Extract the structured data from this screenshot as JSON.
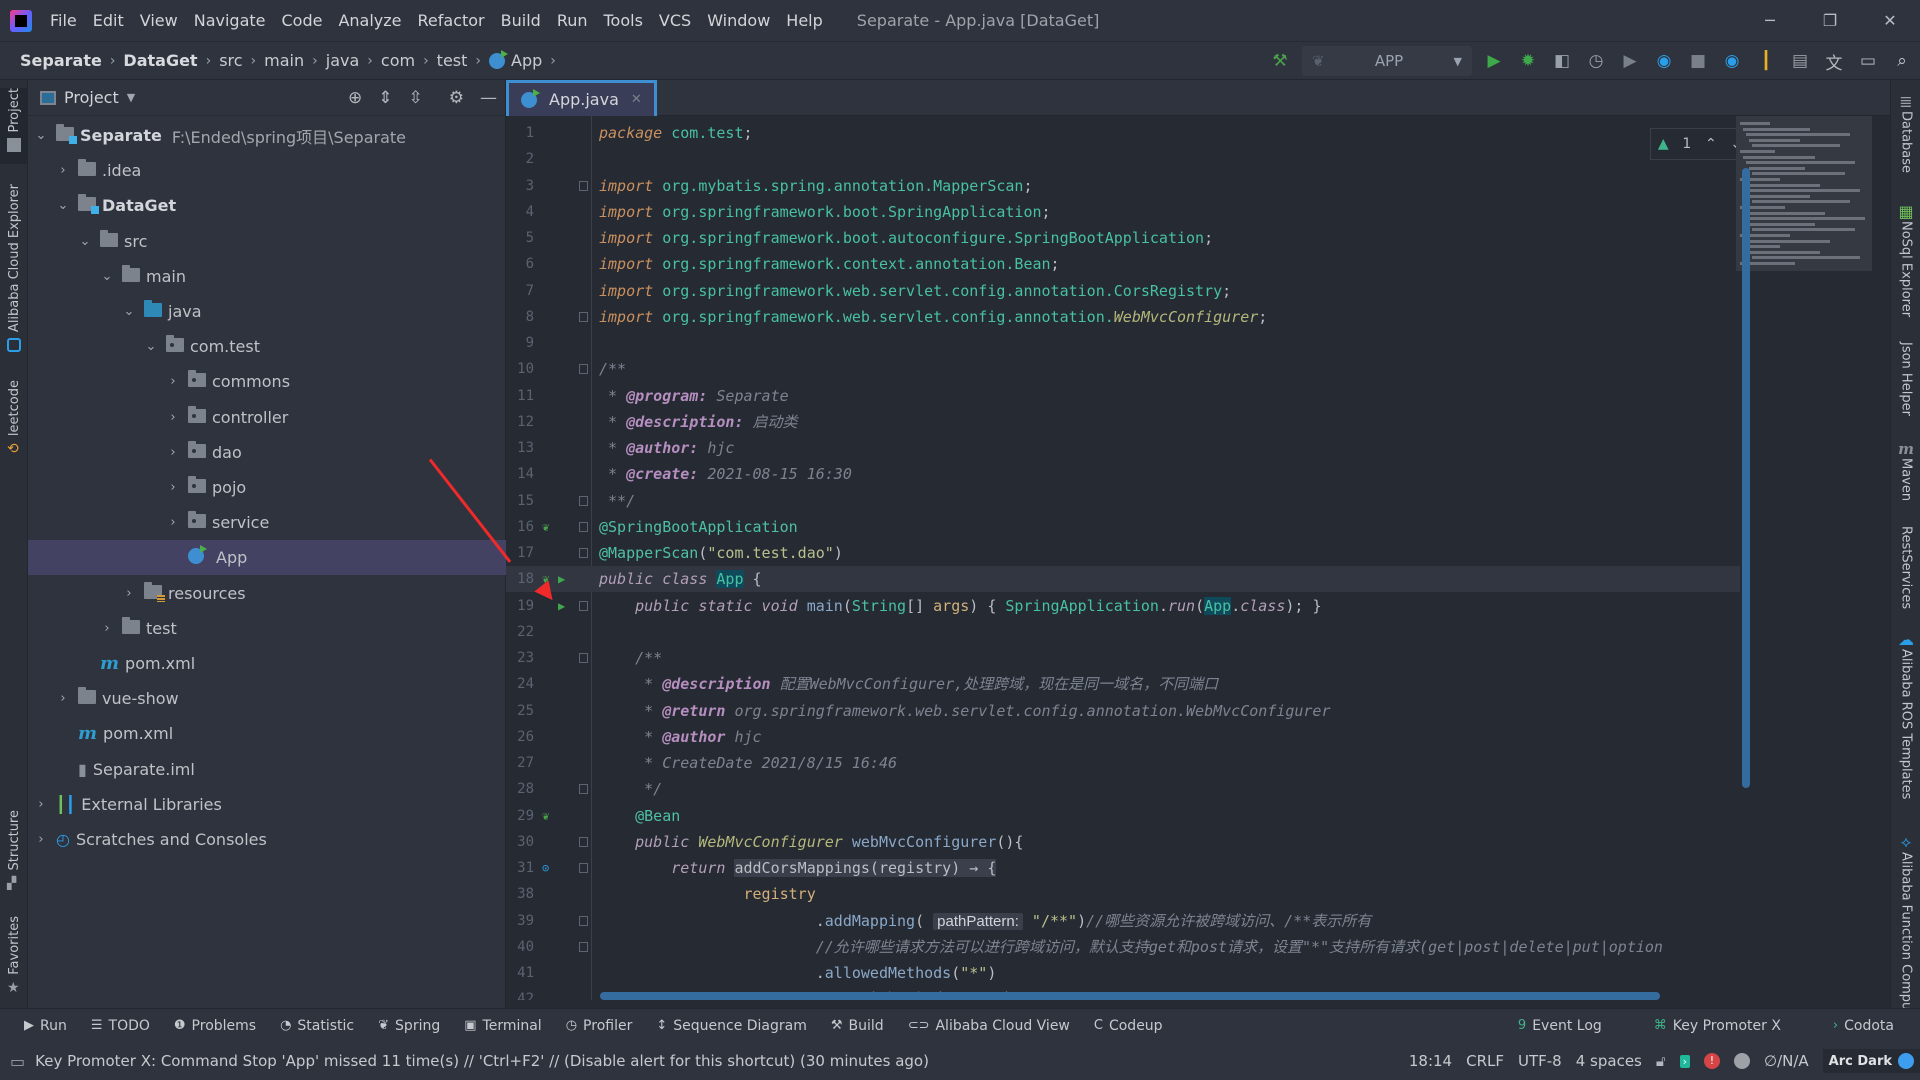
{
  "window": {
    "title": "Separate - App.java [DataGet]",
    "menu": [
      "File",
      "Edit",
      "View",
      "Navigate",
      "Code",
      "Analyze",
      "Refactor",
      "Build",
      "Run",
      "Tools",
      "VCS",
      "Window",
      "Help"
    ],
    "controls": {
      "minimize": "─",
      "maximize": "❐",
      "close": "✕"
    }
  },
  "breadcrumb": [
    "Separate",
    "DataGet",
    "src",
    "main",
    "java",
    "com",
    "test",
    "App"
  ],
  "toolbar": {
    "run_config": "APP",
    "icons": [
      "build-hammer-icon",
      "run-icon",
      "debug-icon",
      "coverage-icon",
      "profile-icon",
      "run-dropdown-icon",
      "resume-icon",
      "dashboard-icon",
      "stop-icon",
      "tool-icon",
      "git-icon",
      "project-structure-icon",
      "translate-icon",
      "presentation-icon",
      "search-icon"
    ]
  },
  "left_strip": [
    "Project",
    "Alibaba Cloud Explorer",
    "leetcode",
    "Structure",
    "Favorites"
  ],
  "project": {
    "title": "Project",
    "tree": [
      {
        "label": "Separate",
        "path": "F:\\Ended\\spring项目\\Separate",
        "depth": 0,
        "expanded": true,
        "icon": "module",
        "bold": true
      },
      {
        "label": ".idea",
        "depth": 1,
        "expanded": false,
        "icon": "folder"
      },
      {
        "label": "DataGet",
        "depth": 1,
        "expanded": true,
        "icon": "module",
        "bold": true
      },
      {
        "label": "src",
        "depth": 2,
        "expanded": true,
        "icon": "folder"
      },
      {
        "label": "main",
        "depth": 3,
        "expanded": true,
        "icon": "folder"
      },
      {
        "label": "java",
        "depth": 4,
        "expanded": true,
        "icon": "src"
      },
      {
        "label": "com.test",
        "depth": 5,
        "expanded": true,
        "icon": "pkg"
      },
      {
        "label": "commons",
        "depth": 6,
        "expanded": false,
        "icon": "pkg"
      },
      {
        "label": "controller",
        "depth": 6,
        "expanded": false,
        "icon": "pkg"
      },
      {
        "label": "dao",
        "depth": 6,
        "expanded": false,
        "icon": "pkg"
      },
      {
        "label": "pojo",
        "depth": 6,
        "expanded": false,
        "icon": "pkg"
      },
      {
        "label": "service",
        "depth": 6,
        "expanded": false,
        "icon": "pkg"
      },
      {
        "label": "App",
        "depth": 6,
        "icon": "app",
        "selected": true
      },
      {
        "label": "resources",
        "depth": 4,
        "expanded": false,
        "icon": "res"
      },
      {
        "label": "test",
        "depth": 3,
        "expanded": false,
        "icon": "folder"
      },
      {
        "label": "pom.xml",
        "depth": 2,
        "icon": "maven"
      },
      {
        "label": "vue-show",
        "depth": 1,
        "expanded": false,
        "icon": "folder"
      },
      {
        "label": "pom.xml",
        "depth": 1,
        "icon": "maven"
      },
      {
        "label": "Separate.iml",
        "depth": 1,
        "icon": "iml"
      },
      {
        "label": "External Libraries",
        "depth": 0,
        "expanded": false,
        "icon": "lib"
      },
      {
        "label": "Scratches and Consoles",
        "depth": 0,
        "expanded": false,
        "icon": "scratch"
      }
    ]
  },
  "editor": {
    "tab": "App.java",
    "inspection": {
      "warnings": "1"
    },
    "lines": [
      {
        "n": "1",
        "html": "<span class='kw'>package</span> <span class='pk'>com.test</span>;"
      },
      {
        "n": "2",
        "html": ""
      },
      {
        "n": "3",
        "html": "<span class='kw'>import</span> <span class='pk'>org.mybatis.spring.annotation.MapperScan</span>;"
      },
      {
        "n": "4",
        "html": "<span class='kw'>import</span> <span class='pk'>org.springframework.boot.SpringApplication</span>;"
      },
      {
        "n": "5",
        "html": "<span class='kw'>import</span> <span class='pk'>org.springframework.boot.autoconfigure.SpringBootApplication</span>;"
      },
      {
        "n": "6",
        "html": "<span class='kw'>import</span> <span class='pk'>org.springframework.context.annotation.Bean</span>;"
      },
      {
        "n": "7",
        "html": "<span class='kw'>import</span> <span class='pk'>org.springframework.web.servlet.config.annotation.CorsRegistry</span>;"
      },
      {
        "n": "8",
        "html": "<span class='kw'>import</span> <span class='pk'>org.springframework.web.servlet.config.annotation.</span><span class='ty'>WebMvcConfigurer</span>;"
      },
      {
        "n": "9",
        "html": ""
      },
      {
        "n": "10",
        "html": "<span class='cm'>/**</span>"
      },
      {
        "n": "11",
        "html": "<span class='cm'> * </span><span class='dt'>@program:</span><span class='cm'> Separate</span>"
      },
      {
        "n": "12",
        "html": "<span class='cm'> * </span><span class='dt'>@description:</span><span class='cm'> 启动类</span>"
      },
      {
        "n": "13",
        "html": "<span class='cm'> * </span><span class='dt'>@author:</span><span class='cm'> hjc</span>"
      },
      {
        "n": "14",
        "html": "<span class='cm'> * </span><span class='dt'>@create:</span><span class='cm'> 2021-08-15 16:30</span>"
      },
      {
        "n": "15",
        "html": "<span class='cm'> **/</span>"
      },
      {
        "n": "16",
        "html": "<span class='an'>@SpringBootApplication</span>"
      },
      {
        "n": "17",
        "html": "<span class='an'>@MapperScan</span>(<span class='str'>\"com.test.dao\"</span>)"
      },
      {
        "n": "18",
        "html": "<span class='kw2'>public class</span> <span class='hl'>App</span> {",
        "current": true
      },
      {
        "n": "19",
        "html": "    <span class='kw2'>public static void</span> <span class='fn'>main</span>(<span class='pk'>String</span>[] <span class='pa'>args</span>) { <span class='pk'>SpringApplication</span>.<span class='kw2'>run</span>(<span class='hl'>App</span>.<span class='kw2'>class</span>); }"
      },
      {
        "n": "22",
        "html": ""
      },
      {
        "n": "23",
        "html": "    <span class='cm'>/**</span>"
      },
      {
        "n": "24",
        "html": "<span class='cm'>     * </span><span class='dt'>@description</span><span class='cm'> 配置WebMvcConfigurer,处理跨域，现在是同一域名，不同端口</span>"
      },
      {
        "n": "25",
        "html": "<span class='cm'>     * </span><span class='dt'>@return</span><span class='cm'> org.springframework.web.servlet.config.annotation.WebMvcConfigurer</span>"
      },
      {
        "n": "26",
        "html": "<span class='cm'>     * </span><span class='dt'>@author</span><span class='cm'> hjc</span>"
      },
      {
        "n": "27",
        "html": "<span class='cm'>     * CreateDate 2021/8/15 16:46</span>"
      },
      {
        "n": "28",
        "html": "<span class='cm'>     */</span>"
      },
      {
        "n": "29",
        "html": "    <span class='an'>@Bean</span>"
      },
      {
        "n": "30",
        "html": "    <span class='kw2'>public</span> <span class='ty'>WebMvcConfigurer</span> <span class='fn'>webMvcConfigurer</span>(){"
      },
      {
        "n": "31",
        "html": "        <span class='kw2'>return</span> <span style='background:#3a3f4b'>addCorsMappings(registry) → {</span>"
      },
      {
        "n": "38",
        "html": "                <span class='pa'>registry</span>"
      },
      {
        "n": "39",
        "html": "                        .<span class='fn'>addMapping</span>( <span class='hint'>pathPattern:</span> <span class='str'>\"/**\"</span>)<span class='cm'>//哪些资源允许被跨域访问、/**表示所有</span>"
      },
      {
        "n": "40",
        "html": "                        <span class='cm'>//允许哪些请求方法可以进行跨域访问，默认支持get和post请求，设置\"*\"支持所有请求(get|post|delete|put|option</span>"
      },
      {
        "n": "41",
        "html": "                        .<span class='fn'>allowedMethods</span>(<span class='str'>\"*\"</span>)"
      },
      {
        "n": "42",
        "html": "                        <span class='cm'>//是否允许证书（cookies）</span>"
      }
    ]
  },
  "right_strip": [
    "Database",
    "NoSql Explorer",
    "Json Helper",
    "Maven",
    "RestServices",
    "Alibaba ROS Templates",
    "Alibaba Function Compute"
  ],
  "bottom_tools": {
    "left": [
      {
        "label": "Run",
        "icon": "▶"
      },
      {
        "label": "TODO",
        "icon": "☰"
      },
      {
        "label": "Problems",
        "icon": "❶"
      },
      {
        "label": "Statistic",
        "icon": "◔"
      },
      {
        "label": "Spring",
        "icon": "❦"
      },
      {
        "label": "Terminal",
        "icon": "▣"
      },
      {
        "label": "Profiler",
        "icon": "◷"
      },
      {
        "label": "Sequence Diagram",
        "icon": "↕"
      },
      {
        "label": "Build",
        "icon": "⚒"
      },
      {
        "label": "Alibaba Cloud View",
        "icon": "⊂⊃"
      },
      {
        "label": "Codeup",
        "icon": "C"
      }
    ],
    "right": [
      {
        "label": "Event Log",
        "icon": "9"
      },
      {
        "label": "Key Promoter X",
        "icon": "⌘"
      },
      {
        "label": "Codota",
        "icon": "›"
      }
    ]
  },
  "status": {
    "message": "Key Promoter X: Command Stop 'App' missed 11 time(s) // 'Ctrl+F2' // (Disable alert for this shortcut) (30 minutes ago)",
    "position": "18:14",
    "line_separator": "CRLF",
    "encoding": "UTF-8",
    "indent": "4 spaces",
    "vcs": "∅/N/A",
    "theme": "Arc Dark"
  },
  "colors": {
    "accent": "#3d8fd1",
    "selection": "#434263",
    "editor_bg": "#262a33",
    "panel_bg": "#2f333d",
    "annotation_arrow": "#f02a2a"
  }
}
